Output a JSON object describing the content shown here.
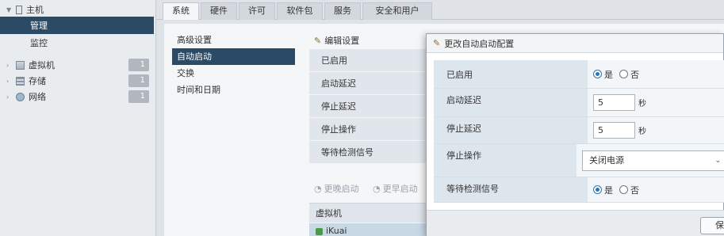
{
  "nav": {
    "host": "主机",
    "manage": "管理",
    "monitor": "监控",
    "vms": {
      "label": "虚拟机",
      "count": "1"
    },
    "storage": {
      "label": "存储",
      "count": "1"
    },
    "network": {
      "label": "网络",
      "count": "1"
    }
  },
  "tabs": [
    "系统",
    "硬件",
    "许可",
    "软件包",
    "服务",
    "安全和用户"
  ],
  "subnav": [
    "高级设置",
    "自动启动",
    "交换",
    "时间和日期"
  ],
  "toolbar": {
    "edit_settings": "编辑设置"
  },
  "settings_rows": [
    "已启用",
    "启动延迟",
    "停止延迟",
    "停止操作",
    "等待检测信号"
  ],
  "vm_actions": {
    "later": "更晚启动",
    "earlier": "更早启动"
  },
  "vm_table": {
    "header": "虚拟机",
    "row": "iKuai"
  },
  "dialog": {
    "title": "更改自动启动配置",
    "enabled_label": "已启用",
    "start_delay_label": "启动延迟",
    "stop_delay_label": "停止延迟",
    "stop_action_label": "停止操作",
    "heartbeat_label": "等待检测信号",
    "yes": "是",
    "no": "否",
    "start_delay_value": "5",
    "stop_delay_value": "5",
    "seconds": "秒",
    "stop_action_value": "关闭电源",
    "save": "保"
  }
}
